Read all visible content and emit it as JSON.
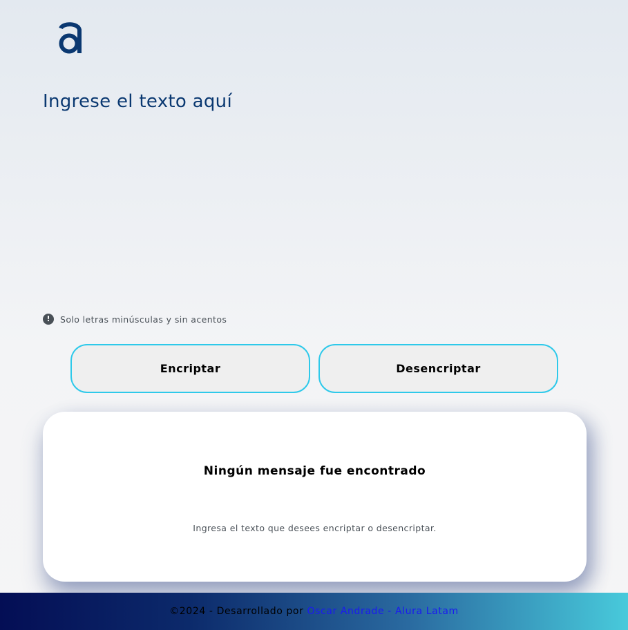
{
  "logo": {
    "icon": "alura-a-logo",
    "color": "#0a3871"
  },
  "input": {
    "placeholder": "Ingrese el texto aquí",
    "value": ""
  },
  "hint": {
    "icon": "exclamation-circle-icon",
    "text": "Solo letras minúsculas y sin acentos"
  },
  "buttons": {
    "encrypt_label": "Encriptar",
    "decrypt_label": "Desencriptar"
  },
  "result": {
    "title": "Ningún mensaje fue encontrado",
    "description": "Ingresa el texto que desees encriptar o desencriptar."
  },
  "footer": {
    "prefix": "©2024 - Desarrollado por",
    "link_text": "Oscar Andrade - Alura Latam"
  },
  "colors": {
    "primary": "#0a3871",
    "button_border": "#2ec9ea",
    "link": "#1a1af0"
  }
}
